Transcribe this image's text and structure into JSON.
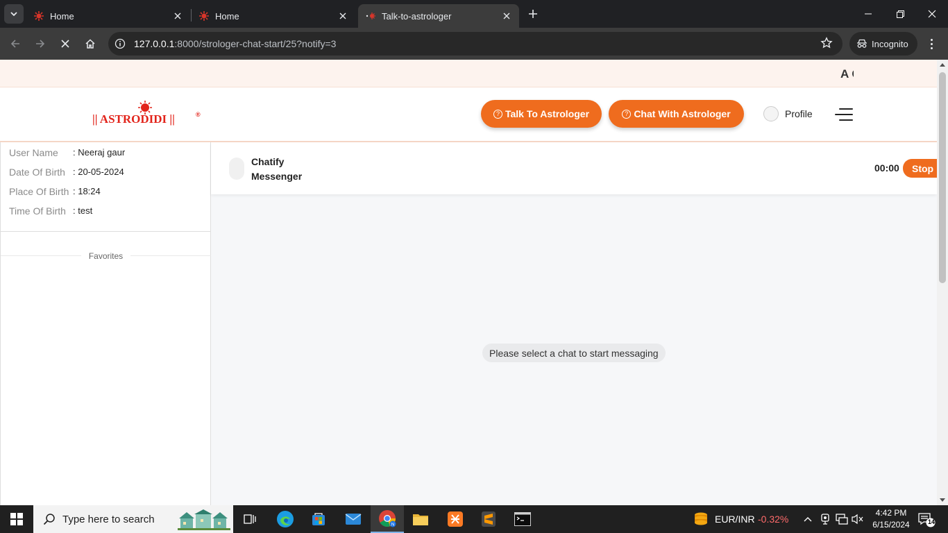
{
  "browser": {
    "tabs": [
      {
        "title": "Home"
      },
      {
        "title": "Home"
      },
      {
        "title": "Talk-to-astrologer"
      }
    ],
    "url_host": "127.0.0.1",
    "url_path": ":8000/strologer-chat-start/25?notify=3",
    "incognito_label": "Incognito"
  },
  "announcement": {
    "text": "A C"
  },
  "header": {
    "logo_text": "|| ASTRODIDI ||",
    "talk_button": "Talk To Astrologer",
    "chat_button": "Chat With Astrologer",
    "profile_label": "Profile",
    "accent_color": "#ef6c1e"
  },
  "user_info": {
    "rows": [
      {
        "label": "User Name",
        "value": ": Neeraj gaur"
      },
      {
        "label": "Date Of Birth",
        "value": ": 20-05-2024"
      },
      {
        "label": "Place Of Birth",
        "value": ": 18:24"
      },
      {
        "label": "Time Of Birth",
        "value": ": test"
      }
    ],
    "favorites_label": "Favorites"
  },
  "chat": {
    "title_line1": "Chatify",
    "title_line2": "Messenger",
    "timer": "00:00",
    "stop_button": "Stop",
    "empty_message": "Please select a chat to start messaging"
  },
  "taskbar": {
    "search_placeholder": "Type here to search",
    "ticker_pair": "EUR/INR",
    "ticker_change": "-0.32%",
    "time": "4:42 PM",
    "date": "6/15/2024",
    "notification_count": "14"
  }
}
